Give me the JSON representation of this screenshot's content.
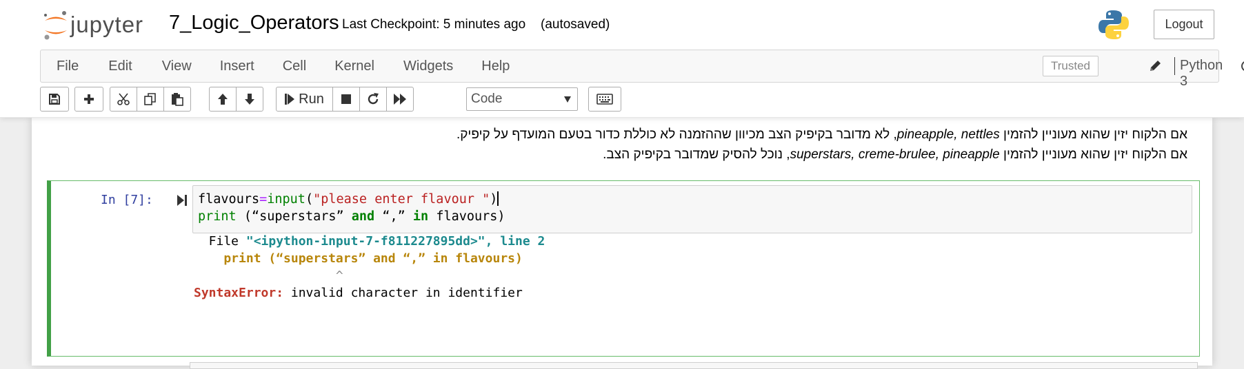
{
  "header": {
    "logo_text": "jupyter",
    "notebook_name": "7_Logic_Operators",
    "checkpoint": "Last Checkpoint: 5 minutes ago",
    "autosave": "(autosaved)",
    "logout_label": "Logout",
    "python_logo_icon": "python-logo-icon"
  },
  "menubar": {
    "items": [
      "File",
      "Edit",
      "View",
      "Insert",
      "Cell",
      "Kernel",
      "Widgets",
      "Help"
    ],
    "trusted_label": "Trusted",
    "kernel_name": "Python 3"
  },
  "toolbar": {
    "run_label": "Run",
    "cell_type": "Code",
    "icons": [
      "save-icon",
      "plus-icon",
      "cut-icon",
      "copy-icon",
      "paste-icon",
      "arrow-up-icon",
      "arrow-down-icon",
      "step-forward-icon",
      "stop-icon",
      "restart-icon",
      "fast-forward-icon",
      "keyboard-icon"
    ]
  },
  "markdown": {
    "line1": "אם הלקוח יזין שהוא מעוניין להזמין pineapple, nettles, לא מדובר בקיפיק הצב מכיוון שההזמנה לא כוללת כדור בטעם המועדף על קיפיק.",
    "line1_part_he_a": "אם הלקוח יזין שהוא מעוניין להזמין ",
    "line1_part_en": "pineapple, nettles",
    "line1_part_he_b": ", לא מדובר בקיפיק הצב מכיוון שההזמנה לא כוללת כדור בטעם המועדף על קיפיק.",
    "line2_part_he_a": "אם הלקוח יזין שהוא מעוניין להזמין ",
    "line2_part_en": "superstars, creme-brulee, pineapple",
    "line2_part_he_b": ", נוכל להסיק שמדובר בקיפיק הצב."
  },
  "cell": {
    "prompt": "In [7]:",
    "code_line1_var": "flavours",
    "code_line1_op": "=",
    "code_line1_fn": "input",
    "code_line1_open": "(",
    "code_line1_str": "\"please enter flavour \"",
    "code_line1_close": ")",
    "code_line2_fn": "print",
    "code_line2_a": " (“superstars” ",
    "code_line2_and": "and",
    "code_line2_b": " “,” ",
    "code_line2_in": "in",
    "code_line2_c": " flavours)",
    "output_file_prefix": "  File ",
    "output_file": "\"<ipython-input-7-f811227895dd>\", line 2",
    "output_code": "    print (“superstars” and “,” in flavours)",
    "output_caret": "                   ^",
    "output_error_type": "SyntaxError:",
    "output_error_msg": " invalid character in identifier"
  }
}
